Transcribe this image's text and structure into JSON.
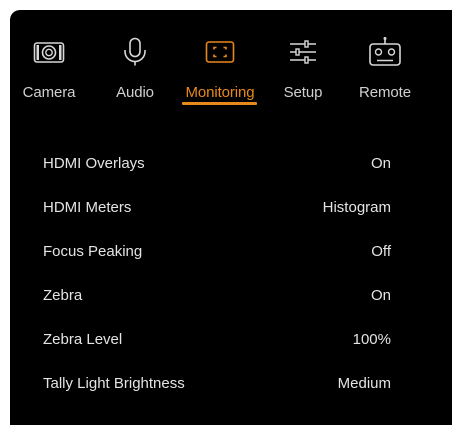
{
  "tabs": [
    {
      "id": "camera",
      "label": "Camera",
      "icon": "camera-icon",
      "active": false
    },
    {
      "id": "audio",
      "label": "Audio",
      "icon": "microphone-icon",
      "active": false
    },
    {
      "id": "monitoring",
      "label": "Monitoring",
      "icon": "monitoring-frame-icon",
      "active": true
    },
    {
      "id": "setup",
      "label": "Setup",
      "icon": "sliders-icon",
      "active": false
    },
    {
      "id": "remote",
      "label": "Remote",
      "icon": "remote-controller-icon",
      "active": false
    }
  ],
  "settings": [
    {
      "name": "HDMI Overlays",
      "value": "On"
    },
    {
      "name": "HDMI Meters",
      "value": "Histogram"
    },
    {
      "name": "Focus Peaking",
      "value": "Off"
    },
    {
      "name": "Zebra",
      "value": "On"
    },
    {
      "name": "Zebra Level",
      "value": "100%"
    },
    {
      "name": "Tally Light Brightness",
      "value": "Medium"
    }
  ],
  "colors": {
    "background": "#000000",
    "text": "#e4e4e4",
    "accent": "#e8891c"
  }
}
